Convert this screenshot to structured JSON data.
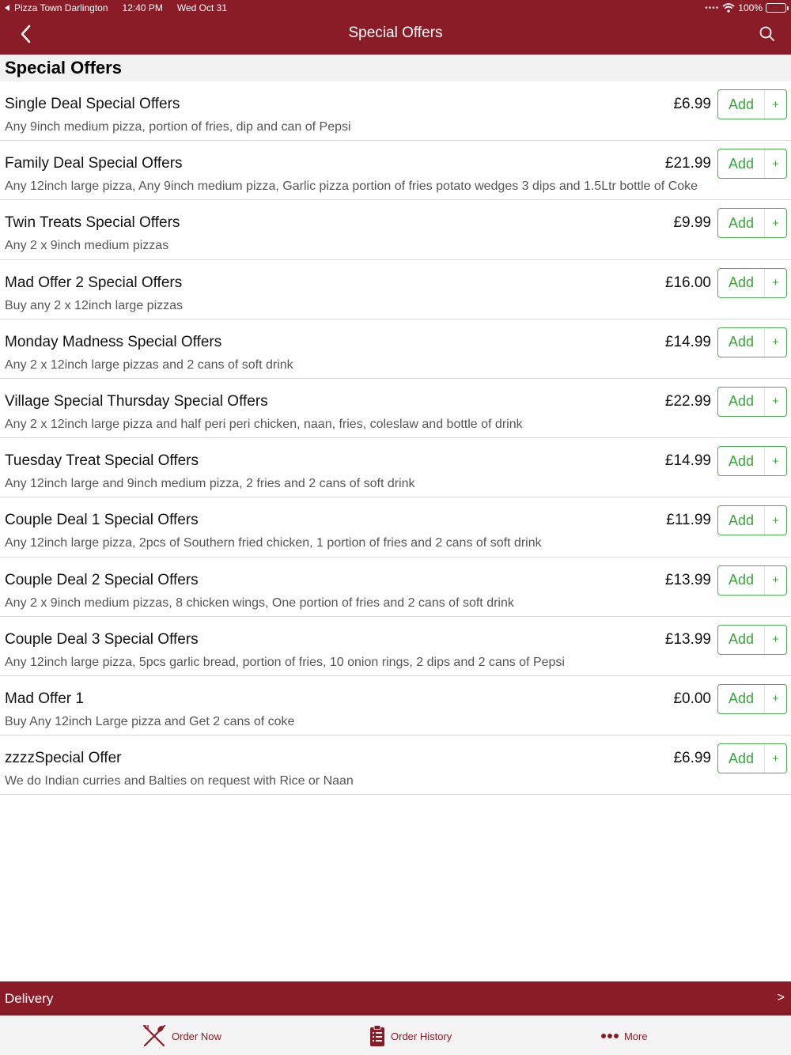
{
  "status_bar": {
    "back_app": "Pizza Town Darlington",
    "time": "12:40 PM",
    "date": "Wed Oct 31",
    "battery": "100%"
  },
  "nav": {
    "title": "Special Offers",
    "back_icon": "chevron-left-icon",
    "search_icon": "search-icon"
  },
  "section": {
    "title": "Special Offers"
  },
  "offers": [
    {
      "name": "Single Deal Special Offers",
      "price": "£6.99",
      "description": "Any 9inch medium pizza, portion of fries, dip and can of Pepsi"
    },
    {
      "name": "Family Deal Special Offers",
      "price": "£21.99",
      "description": "Any 12inch large pizza, Any 9inch medium pizza, Garlic pizza portion of fries potato wedges 3 dips and 1.5Ltr bottle of Coke"
    },
    {
      "name": "Twin Treats Special Offers",
      "price": "£9.99",
      "description": "Any 2 x 9inch medium pizzas"
    },
    {
      "name": "Mad Offer 2 Special Offers",
      "price": "£16.00",
      "description": "Buy any 2 x 12inch large pizzas"
    },
    {
      "name": "Monday Madness Special Offers",
      "price": "£14.99",
      "description": "Any 2 x 12inch large pizzas and 2 cans of soft drink"
    },
    {
      "name": "Village Special Thursday Special Offers",
      "price": "£22.99",
      "description": "Any 2 x 12inch large pizza and half peri peri chicken, naan, fries, coleslaw and bottle of drink"
    },
    {
      "name": "Tuesday Treat Special Offers",
      "price": "£14.99",
      "description": "Any 12inch large and 9inch medium pizza, 2 fries and 2 cans of soft drink"
    },
    {
      "name": "Couple Deal 1 Special Offers",
      "price": "£11.99",
      "description": "Any 12inch large pizza, 2pcs of Southern fried chicken, 1 portion of fries and 2 cans of soft drink"
    },
    {
      "name": "Couple Deal 2 Special Offers",
      "price": "£13.99",
      "description": "Any 2 x 9inch medium pizzas, 8 chicken wings, One portion of fries and 2 cans of soft drink"
    },
    {
      "name": "Couple Deal 3 Special Offers",
      "price": "£13.99",
      "description": "Any 12inch large pizza, 5pcs garlic bread, portion of fries, 10 onion rings, 2 dips and 2 cans of Pepsi"
    },
    {
      "name": "Mad Offer 1",
      "price": "£0.00",
      "description": "Buy Any 12inch Large pizza and Get 2 cans of coke"
    },
    {
      "name": "zzzzSpecial Offer",
      "price": "£6.99",
      "description": "We do Indian curries and Balties on request with Rice or Naan"
    }
  ],
  "add_button": {
    "label": "Add",
    "plus": "+"
  },
  "delivery": {
    "label": "Delivery",
    "arrow": ">"
  },
  "tabs": {
    "order_now": {
      "label": "Order Now",
      "icon": "fork-knife-icon"
    },
    "order_history": {
      "label": "Order History",
      "icon": "clipboard-icon"
    },
    "more": {
      "label": "More",
      "icon": "more-dots-icon"
    }
  },
  "colors": {
    "brand": "#8a1c28",
    "add_green": "#3aa43a",
    "header_bg": "#f2f2f2"
  }
}
